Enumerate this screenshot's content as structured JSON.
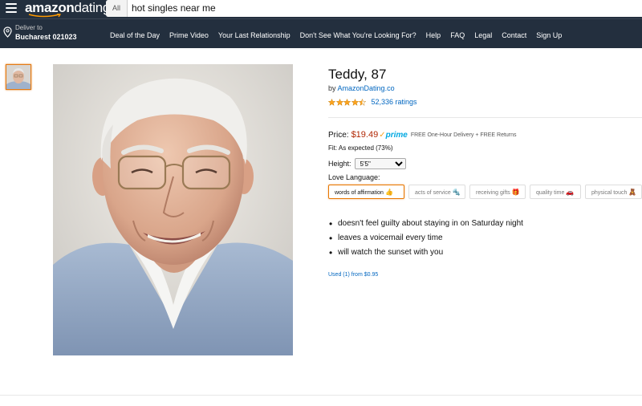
{
  "header": {
    "logo_main": "amazon",
    "logo_sub": "dating",
    "search_category": "All",
    "search_value": "hot singles near me"
  },
  "nav": {
    "deliver_label": "Deliver to",
    "deliver_location": "Bucharest 021023",
    "links": [
      "Deal of the Day",
      "Prime Video",
      "Your Last Relationship",
      "Don't See What You're Looking For?",
      "Help",
      "FAQ",
      "Legal",
      "Contact",
      "Sign Up"
    ]
  },
  "product": {
    "title": "Teddy, 87",
    "by_prefix": "by",
    "brand": "AmazonDating.co",
    "rating_stars": 4.5,
    "ratings_text": "52,336 ratings",
    "price_label": "Price:",
    "price": "$19.49",
    "prime_label": "prime",
    "delivery_text": "FREE One-Hour Delivery + FREE Returns",
    "fit_label": "Fit:",
    "fit_value": "As expected (73%)",
    "height_label": "Height:",
    "height_value": "5'5\"",
    "love_language_label": "Love Language:",
    "love_languages": [
      {
        "label": "words of affirmation",
        "emoji": "👍",
        "selected": true
      },
      {
        "label": "acts of service",
        "emoji": "🔩",
        "selected": false
      },
      {
        "label": "receiving gifts",
        "emoji": "🎁",
        "selected": false
      },
      {
        "label": "quality time",
        "emoji": "🚗",
        "selected": false
      },
      {
        "label": "physical touch",
        "emoji": "🧸",
        "selected": false
      }
    ],
    "bullets": [
      "doesn't feel guilty about staying in on Saturday night",
      "leaves a voicemail every time",
      "will watch the sunset with you"
    ],
    "used_offer": "Used (1) from $0.95"
  },
  "colors": {
    "topbar": "#232f3e",
    "link": "#0066c0",
    "price": "#b12704",
    "prime": "#00a8e1",
    "selected_border": "#e77600",
    "star": "#ffa41c"
  }
}
